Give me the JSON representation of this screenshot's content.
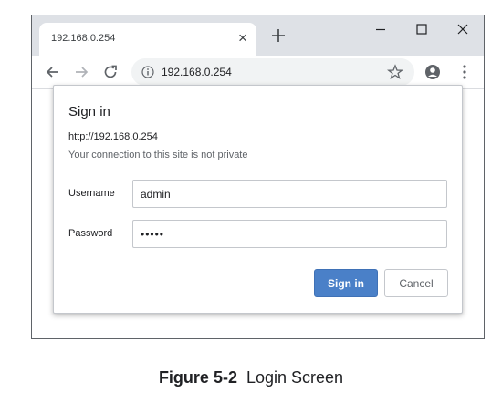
{
  "browser": {
    "tab_title": "192.168.0.254",
    "tab_close": "×",
    "url": "192.168.0.254"
  },
  "dialog": {
    "title": "Sign in",
    "url": "http://192.168.0.254",
    "warning": "Your connection to this site is not private",
    "username_label": "Username",
    "username_value": "admin",
    "password_label": "Password",
    "password_value": "•••••",
    "sign_in_label": "Sign in",
    "cancel_label": "Cancel"
  },
  "caption": {
    "number": "Figure 5-2",
    "text": "Login Screen"
  },
  "icons": {
    "new_tab": "plus-icon",
    "minimize": "minimize-icon",
    "maximize": "maximize-icon",
    "close": "close-icon",
    "back": "back-arrow-icon",
    "forward": "forward-arrow-icon",
    "reload": "reload-icon",
    "site_info": "info-icon",
    "bookmark": "star-icon",
    "profile": "profile-icon",
    "menu": "kebab-menu-icon"
  },
  "colors": {
    "primary_button": "#4a80c8",
    "title_bar": "#dee1e6"
  }
}
